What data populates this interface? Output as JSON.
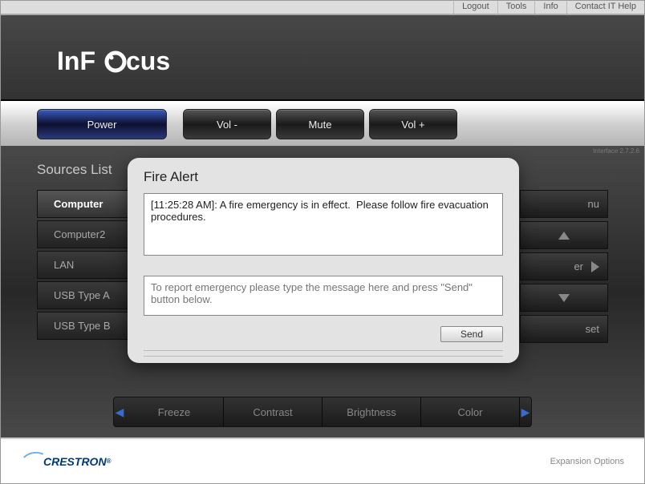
{
  "topnav": {
    "logout": "Logout",
    "tools": "Tools",
    "info": "Info",
    "contact": "Contact IT Help"
  },
  "logo": {
    "text": "InFocus"
  },
  "buttons": {
    "power": "Power",
    "vol_minus": "Vol -",
    "mute": "Mute",
    "vol_plus": "Vol +"
  },
  "version": "Interface 2.7.2.6",
  "sources": {
    "title": "Sources List",
    "items": [
      "Computer",
      "Computer2",
      "LAN",
      "USB Type A",
      "USB Type B"
    ],
    "active_index": 0
  },
  "right": {
    "menu": "nu",
    "enter": "er",
    "reset": "set"
  },
  "bottom": {
    "items": [
      "Freeze",
      "Contrast",
      "Brightness",
      "Color"
    ]
  },
  "footer": {
    "brand": "CRESTRON",
    "expansion": "Expansion Options"
  },
  "modal": {
    "title": "Fire Alert",
    "message": "[11:25:28 AM]: A fire emergency is in effect.  Please follow fire evacuation procedures.",
    "placeholder": "To report emergency please type the message here and press \"Send\" button below.",
    "send": "Send"
  }
}
